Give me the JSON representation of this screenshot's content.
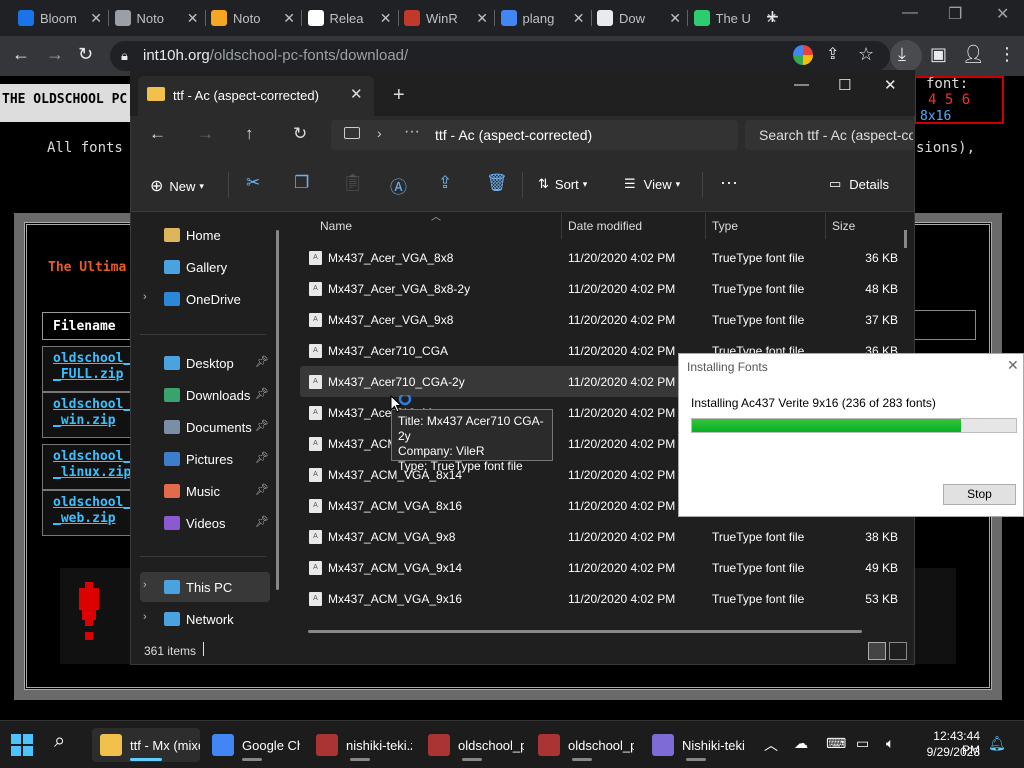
{
  "browser": {
    "tabs": [
      {
        "title": "Bloom",
        "color": "#1a73e8"
      },
      {
        "title": "Noto",
        "color": "#9aa0a6"
      },
      {
        "title": "Noto",
        "color": "#f5a623"
      },
      {
        "title": "Relea",
        "color": "#ffffff"
      },
      {
        "title": "WinR",
        "color": "#c0392b"
      },
      {
        "title": "plang",
        "color": "#4285f4"
      },
      {
        "title": "Dow",
        "color": "#e8eaed"
      },
      {
        "title": "The U",
        "color": "#2ecc71"
      }
    ],
    "url_domain": "int10h.org",
    "url_path": "/oldschool-pc-fonts/download/"
  },
  "site": {
    "header_title": "THE OLDSCHOOL PC",
    "intro_text": "All fonts",
    "intro_suffix": "sions),",
    "font_label": "font:",
    "font_nums": "4 5 6",
    "font_size": "8x16",
    "section_title": "The Ultima",
    "table_header": "Filename",
    "downloads": [
      "oldschool_\n_FULL.zip",
      "oldschool_\n_win.zip",
      "oldschool_\n_linux.zip",
      "oldschool_\n_web.zip"
    ]
  },
  "explorer": {
    "tab_title": "ttf - Ac (aspect-corrected)",
    "address_path": "ttf - Ac (aspect-corrected)",
    "search_placeholder": "Search ttf - Ac (aspect-co",
    "commands": {
      "new": "New",
      "sort": "Sort",
      "view": "View",
      "details": "Details"
    },
    "sidebar": [
      {
        "label": "Home",
        "color": "#e0b45a"
      },
      {
        "label": "Gallery",
        "color": "#4aa3df"
      },
      {
        "label": "OneDrive",
        "color": "#2b88d8"
      },
      {
        "label": "Desktop",
        "color": "#4aa3df"
      },
      {
        "label": "Downloads",
        "color": "#3aa36b"
      },
      {
        "label": "Documents",
        "color": "#7a8fa6"
      },
      {
        "label": "Pictures",
        "color": "#3c7ec9"
      },
      {
        "label": "Music",
        "color": "#e36a4a"
      },
      {
        "label": "Videos",
        "color": "#8a5ad1"
      },
      {
        "label": "This PC",
        "color": "#4aa3df"
      },
      {
        "label": "Network",
        "color": "#4aa3df"
      }
    ],
    "columns": {
      "name": "Name",
      "date": "Date modified",
      "type": "Type",
      "size": "Size"
    },
    "files": [
      {
        "name": "Mx437_Acer_VGA_8x8",
        "date": "11/20/2020 4:02 PM",
        "type": "TrueType font file",
        "size": "36 KB"
      },
      {
        "name": "Mx437_Acer_VGA_8x8-2y",
        "date": "11/20/2020 4:02 PM",
        "type": "TrueType font file",
        "size": "48 KB"
      },
      {
        "name": "Mx437_Acer_VGA_9x8",
        "date": "11/20/2020 4:02 PM",
        "type": "TrueType font file",
        "size": "37 KB"
      },
      {
        "name": "Mx437_Acer710_CGA",
        "date": "11/20/2020 4:02 PM",
        "type": "TrueType font file",
        "size": "36 KB"
      },
      {
        "name": "Mx437_Acer710_CGA-2y",
        "date": "11/20/2020 4:02 PM",
        "type": "",
        "size": ""
      },
      {
        "name": "Mx437_Acer710_Mono",
        "date": "11/20/2020 4:02 PM",
        "type": "",
        "size": ""
      },
      {
        "name": "Mx437_ACM_VGA_8x8",
        "date": "11/20/2020 4:02 PM",
        "type": "",
        "size": ""
      },
      {
        "name": "Mx437_ACM_VGA_8x14",
        "date": "11/20/2020 4:02 PM",
        "type": "",
        "size": ""
      },
      {
        "name": "Mx437_ACM_VGA_8x16",
        "date": "11/20/2020 4:02 PM",
        "type": "",
        "size": ""
      },
      {
        "name": "Mx437_ACM_VGA_9x8",
        "date": "11/20/2020 4:02 PM",
        "type": "TrueType font file",
        "size": "38 KB"
      },
      {
        "name": "Mx437_ACM_VGA_9x14",
        "date": "11/20/2020 4:02 PM",
        "type": "TrueType font file",
        "size": "49 KB"
      },
      {
        "name": "Mx437_ACM_VGA_9x16",
        "date": "11/20/2020 4:02 PM",
        "type": "TrueType font file",
        "size": "53 KB"
      }
    ],
    "status_count": "361 items",
    "tooltip": {
      "title": "Title: Mx437 Acer710 CGA-2y",
      "company": "Company: VileR",
      "type": "Type: TrueType font file"
    }
  },
  "install_dialog": {
    "title": "Installing Fonts",
    "message": "Installing Ac437 Verite 9x16 (236 of 283 fonts)",
    "progress": 0.83,
    "stop_label": "Stop"
  },
  "taskbar": {
    "items": [
      {
        "label": "ttf - Mx (mixe",
        "color": "#f2c14b"
      },
      {
        "label": "Google Ch",
        "color": "#4285f4"
      },
      {
        "label": "nishiki-teki.zi",
        "color": "#a33"
      },
      {
        "label": "oldschool_pc",
        "color": "#a33"
      },
      {
        "label": "oldschool_pc",
        "color": "#a33"
      },
      {
        "label": "Nishiki-teki (",
        "color": "#7e6bd6"
      }
    ],
    "time": "12:43:44 PM",
    "date": "9/29/2023"
  }
}
